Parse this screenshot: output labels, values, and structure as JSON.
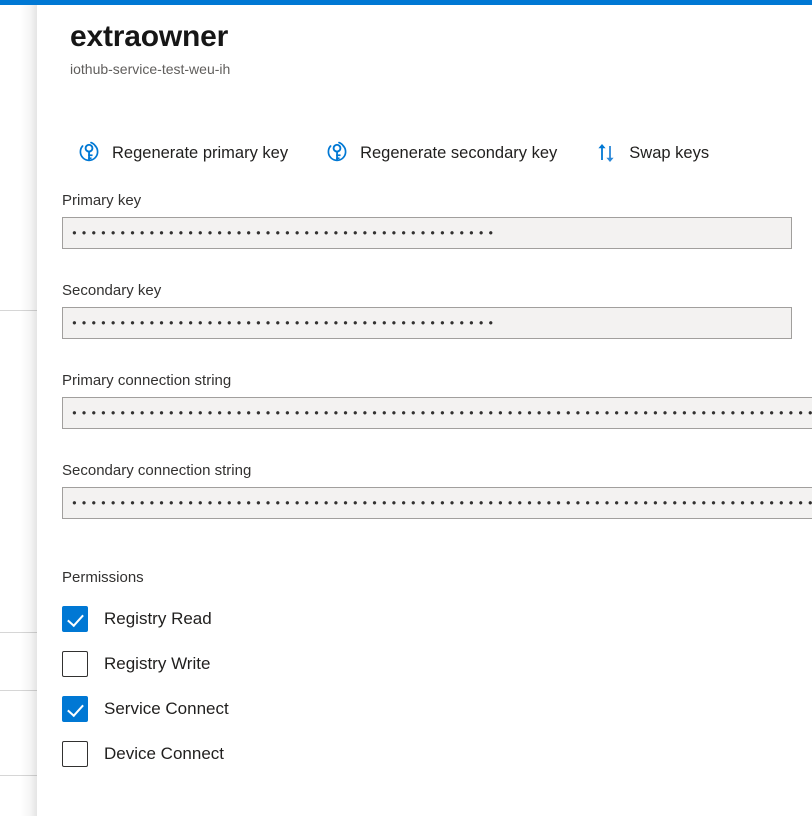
{
  "theme": {
    "accent": "#0078d4",
    "text_primary": "#201f1e",
    "text_secondary": "#605e5c",
    "field_background": "#f3f2f1",
    "field_border": "#a19f9d"
  },
  "header": {
    "title": "extraowner",
    "subtitle": "iothub-service-test-weu-ih"
  },
  "toolbar": {
    "commands": [
      {
        "label": "Regenerate primary key",
        "icon": "key-regenerate-icon"
      },
      {
        "label": "Regenerate secondary key",
        "icon": "key-regenerate-icon"
      },
      {
        "label": "Swap keys",
        "icon": "swap-arrows-icon"
      }
    ]
  },
  "fields": [
    {
      "label": "Primary key",
      "value": "••••••••••••••••••••••••••••••••••••••••••••",
      "masked": true,
      "readonly": true
    },
    {
      "label": "Secondary key",
      "value": "••••••••••••••••••••••••••••••••••••••••••••",
      "masked": true,
      "readonly": true
    },
    {
      "label": "Primary connection string",
      "value": "••••••••••••••••••••••••••••••••••••••••••••••••••••••••••••••••••••••••••••••••••••••••••••••••••",
      "masked": true,
      "readonly": true
    },
    {
      "label": "Secondary connection string",
      "value": "••••••••••••••••••••••••••••••••••••••••••••••••••••••••••••••••••••••••••••••••••••••••••••••••••",
      "masked": true,
      "readonly": true
    }
  ],
  "permissions": {
    "label": "Permissions",
    "items": [
      {
        "label": "Registry Read",
        "checked": true
      },
      {
        "label": "Registry Write",
        "checked": false
      },
      {
        "label": "Service Connect",
        "checked": true
      },
      {
        "label": "Device Connect",
        "checked": false
      }
    ]
  }
}
